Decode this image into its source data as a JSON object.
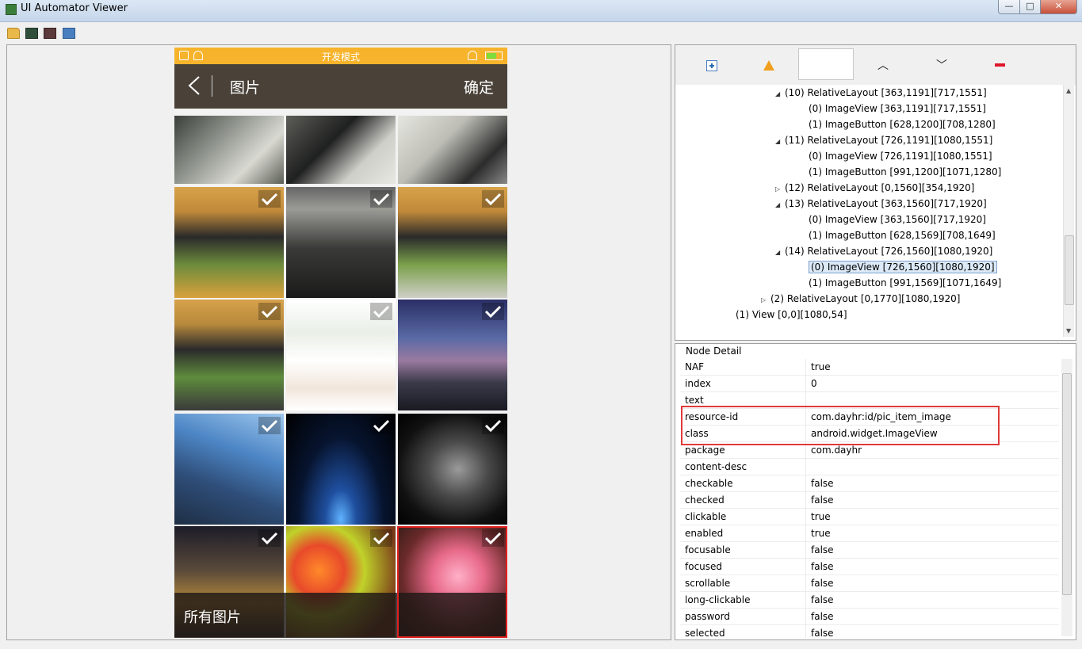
{
  "window": {
    "title": "UI Automator Viewer",
    "minimize": "—",
    "maximize": "□",
    "close": "✕"
  },
  "toolbar": {
    "open_icon": "folder-open-icon",
    "screenshot_icon": "device-screenshot-icon",
    "compressed_screenshot_icon": "device-screenshot-compressed-icon",
    "save_icon": "save-icon"
  },
  "phone": {
    "status_title": "开发模式",
    "battery_color": "#7fdc3c",
    "header_title": "图片",
    "confirm": "确定",
    "bottom_label": "所有图片",
    "tiles": [
      {
        "bg": "linear-gradient(135deg,#3a3f3a,#9fa39c 45%,#d9d9d2 70%,#5a5d55)",
        "check": false
      },
      {
        "bg": "linear-gradient(135deg,#5d5e58,#1f2020 40%,#cfcfc9 70%,#e8e8e2)",
        "check": false
      },
      {
        "bg": "linear-gradient(135deg,#e6e6e0,#bdbdb6 40%,#2c2c2c 75%,#888)",
        "check": false
      },
      {
        "bg": "linear-gradient(180deg,#d7a24a 0%,#c0893a 22%,#2a2a2a 45%,#6d8b3c 70%,#d9a23d)",
        "check": true
      },
      {
        "bg": "linear-gradient(180deg,#666 0%,#9b9b96 20%,#3a3a38 55%,#1a1a1a)",
        "check": true
      },
      {
        "bg": "linear-gradient(180deg,#d7a24a 0%,#c0893a 22%,#2a2a2a 45%,#7aa04a 70%,#cfcfc9)",
        "check": true
      },
      {
        "bg": "linear-gradient(180deg,#d7a24a 0%,#b88a3d 22%,#2a2a2a 45%,#5f8c3d 70%,#3a3a3a)",
        "check": true
      },
      {
        "bg": "linear-gradient(180deg,#ffffff,#e9efe6 30%,#ffffff 55%,#f1e6dc 80%,#ffffff)",
        "check": true
      },
      {
        "bg": "linear-gradient(180deg,#2a2f66,#5a6aa5 35%,#9a7aa0 55%,#3a3a4a 75%,#1a1a22)",
        "check": true
      },
      {
        "bg": "linear-gradient(200deg,#9ec7ee,#4d86c5 35%,#2e4d78 65%,#1f2f45)",
        "check": true
      },
      {
        "bg": "radial-gradient(ellipse at 50% 95%,#5fb2ff 0%,#1f4f9f 20%,#07142f 55%,#000 100%)",
        "check": true
      },
      {
        "bg": "radial-gradient(ellipse at 55% 50%,#9a9a9a 0%,#4a4a4a 35%,#111 70%,#000)",
        "check": true
      },
      {
        "bg": "linear-gradient(180deg,#1c1c28,#5a4a3a 40%,#b88a3a 70%,#2a2a2a)",
        "check": true
      },
      {
        "bg": "radial-gradient(circle at 30% 40%,#ff8a2a 0%,#e84a2a 25%,#c0d22a 45%,#7a3a1a 80%)",
        "check": true
      },
      {
        "bg": "radial-gradient(circle at 55% 45%,#ffb0c8 0%,#e86a8a 30%,#6a2a2a 65%,#2a1a14)",
        "check": true
      }
    ]
  },
  "tree_nodes": [
    {
      "indent": 120,
      "arrow": "◢",
      "text": "(10) RelativeLayout [363,1191][717,1551]"
    },
    {
      "indent": 150,
      "arrow": "",
      "text": "(0) ImageView [363,1191][717,1551]"
    },
    {
      "indent": 150,
      "arrow": "",
      "text": "(1) ImageButton [628,1200][708,1280]"
    },
    {
      "indent": 120,
      "arrow": "◢",
      "text": "(11) RelativeLayout [726,1191][1080,1551]"
    },
    {
      "indent": 150,
      "arrow": "",
      "text": "(0) ImageView [726,1191][1080,1551]"
    },
    {
      "indent": 150,
      "arrow": "",
      "text": "(1) ImageButton [991,1200][1071,1280]"
    },
    {
      "indent": 120,
      "arrow": "▷",
      "text": "(12) RelativeLayout [0,1560][354,1920]"
    },
    {
      "indent": 120,
      "arrow": "◢",
      "text": "(13) RelativeLayout [363,1560][717,1920]"
    },
    {
      "indent": 150,
      "arrow": "",
      "text": "(0) ImageView [363,1560][717,1920]"
    },
    {
      "indent": 150,
      "arrow": "",
      "text": "(1) ImageButton [628,1569][708,1649]"
    },
    {
      "indent": 120,
      "arrow": "◢",
      "text": "(14) RelativeLayout [726,1560][1080,1920]"
    },
    {
      "indent": 150,
      "arrow": "",
      "text": "(0) ImageView [726,1560][1080,1920]",
      "selected": true
    },
    {
      "indent": 150,
      "arrow": "",
      "text": "(1) ImageButton [991,1569][1071,1649]"
    },
    {
      "indent": 102,
      "arrow": "▷",
      "text": "(2) RelativeLayout [0,1770][1080,1920]"
    },
    {
      "indent": 58,
      "arrow": "",
      "text": "(1) View [0,0][1080,54]"
    }
  ],
  "node_detail": {
    "title": "Node Detail",
    "rows": [
      {
        "key": "NAF",
        "value": "true"
      },
      {
        "key": "index",
        "value": "0"
      },
      {
        "key": "text",
        "value": ""
      },
      {
        "key": "resource-id",
        "value": "com.dayhr:id/pic_item_image"
      },
      {
        "key": "class",
        "value": "android.widget.ImageView"
      },
      {
        "key": "package",
        "value": "com.dayhr"
      },
      {
        "key": "content-desc",
        "value": ""
      },
      {
        "key": "checkable",
        "value": "false"
      },
      {
        "key": "checked",
        "value": "false"
      },
      {
        "key": "clickable",
        "value": "true"
      },
      {
        "key": "enabled",
        "value": "true"
      },
      {
        "key": "focusable",
        "value": "false"
      },
      {
        "key": "focused",
        "value": "false"
      },
      {
        "key": "scrollable",
        "value": "false"
      },
      {
        "key": "long-clickable",
        "value": "false"
      },
      {
        "key": "password",
        "value": "false"
      },
      {
        "key": "selected",
        "value": "false"
      }
    ]
  }
}
